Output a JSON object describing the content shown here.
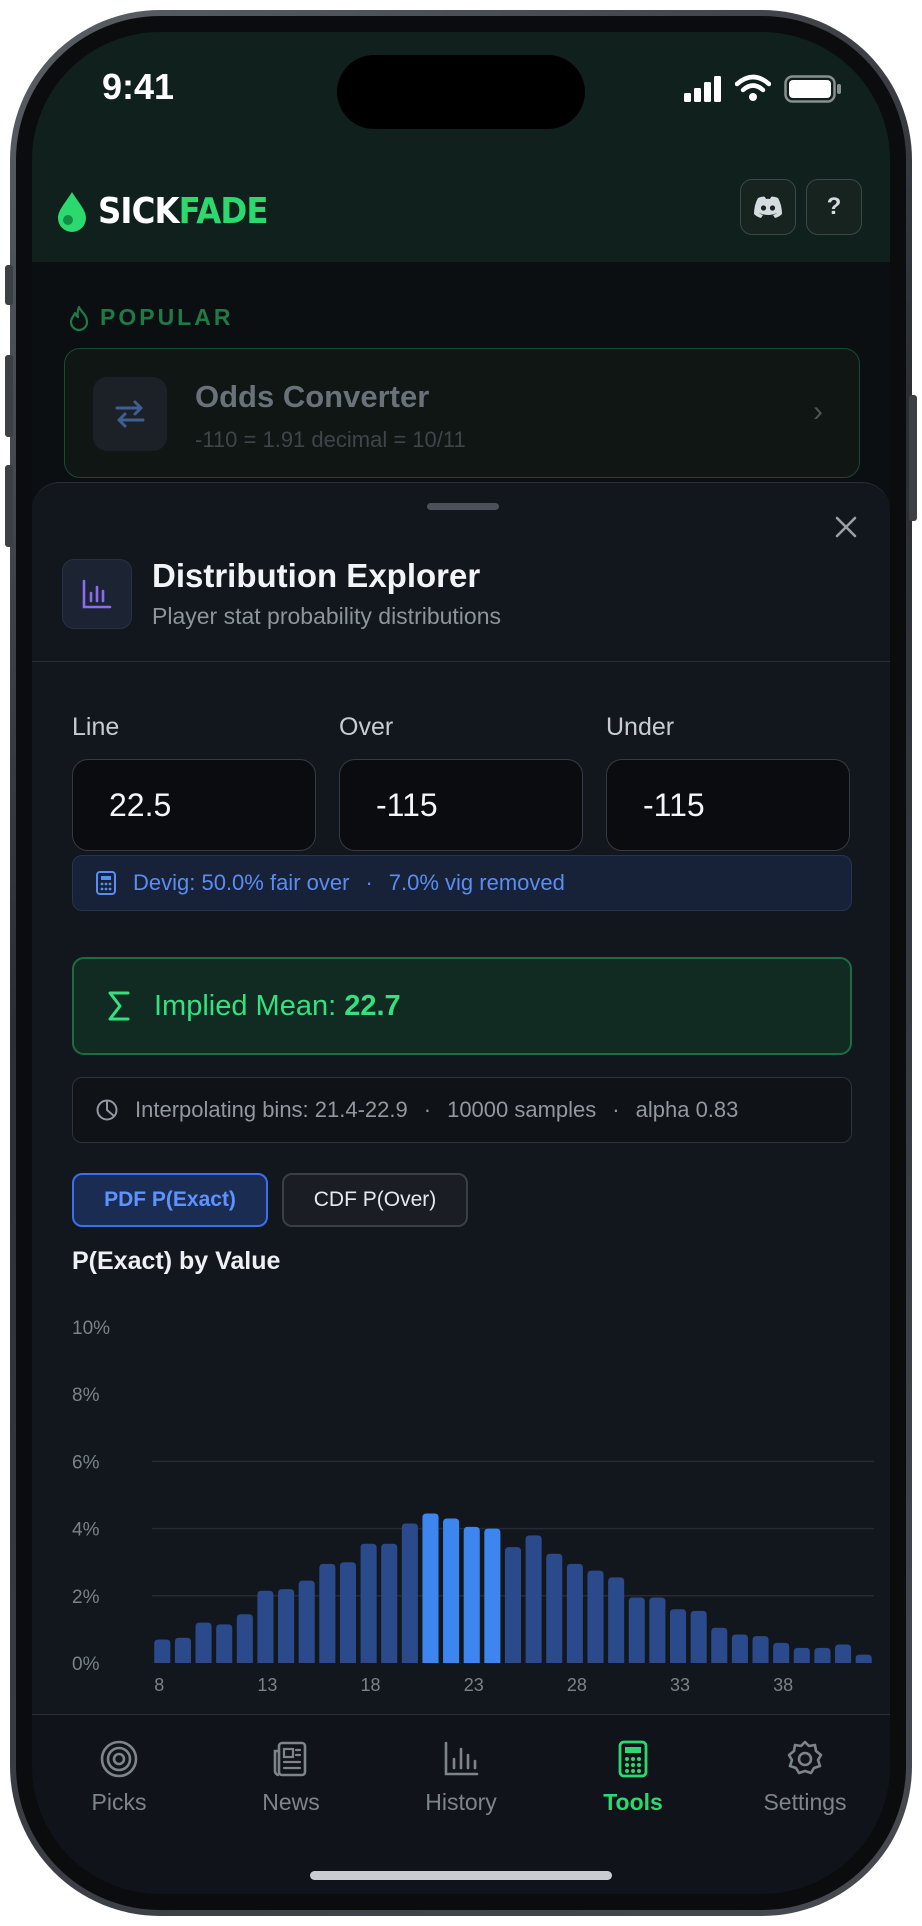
{
  "status": {
    "time": "9:41"
  },
  "brand": {
    "part1": "SICK",
    "part2": "FADE"
  },
  "header": {
    "help_label": "?"
  },
  "popular": {
    "section_label": "POPULAR",
    "card": {
      "title": "Odds Converter",
      "subtitle": "-110 = 1.91 decimal = 10/11"
    }
  },
  "sheet": {
    "title": "Distribution Explorer",
    "subtitle": "Player stat probability distributions",
    "fields": [
      {
        "label": "Line",
        "value": "22.5"
      },
      {
        "label": "Over",
        "value": "-115"
      },
      {
        "label": "Under",
        "value": "-115"
      }
    ],
    "devig": {
      "text1": "Devig: 50.0% fair over",
      "sep": "·",
      "text2": "7.0% vig removed"
    },
    "implied_mean": {
      "label": "Implied Mean:",
      "value": "22.7"
    },
    "interp": {
      "bins": "Interpolating bins: 21.4-22.9",
      "samples": "10000 samples",
      "alpha": "alpha 0.83",
      "sep": "·"
    },
    "toggles": {
      "pdf": "PDF  P(Exact)",
      "cdf": "CDF  P(Over)"
    },
    "chart_title": "P(Exact) by Value"
  },
  "chart_data": {
    "type": "bar",
    "title": "P(Exact) by Value",
    "ylim": [
      0,
      10
    ],
    "y_ticks": [
      "10%",
      "8%",
      "6%",
      "4%",
      "2%",
      "0%"
    ],
    "x_tick_labels": [
      "8",
      "13",
      "18",
      "23",
      "28",
      "33",
      "38"
    ],
    "categories": [
      8,
      9,
      10,
      11,
      12,
      13,
      14,
      15,
      16,
      17,
      18,
      19,
      20,
      21,
      22,
      23,
      24,
      25,
      26,
      27,
      28,
      29,
      30,
      31,
      32,
      33,
      34,
      35,
      36,
      37,
      38,
      39,
      40,
      41,
      42
    ],
    "values": [
      0.7,
      0.75,
      1.2,
      1.15,
      1.45,
      2.15,
      2.2,
      2.45,
      2.95,
      3.0,
      3.55,
      3.55,
      4.15,
      4.45,
      4.3,
      4.05,
      4.0,
      3.45,
      3.8,
      3.25,
      2.95,
      2.75,
      2.55,
      1.95,
      1.95,
      1.6,
      1.55,
      1.05,
      0.85,
      0.8,
      0.6,
      0.45,
      0.45,
      0.55,
      0.25
    ],
    "highlight": [
      21,
      22,
      23,
      24
    ],
    "colors": {
      "bar": "#2b4a8c",
      "highlight": "#3d86f0",
      "grid": "#262b33",
      "tick": "#7b828a"
    }
  },
  "tabs": [
    {
      "label": "Picks",
      "icon": "target-icon",
      "active": false
    },
    {
      "label": "News",
      "icon": "newspaper-icon",
      "active": false
    },
    {
      "label": "History",
      "icon": "bar-chart-icon",
      "active": false
    },
    {
      "label": "Tools",
      "icon": "calculator-icon",
      "active": true
    },
    {
      "label": "Settings",
      "icon": "gear-icon",
      "active": false
    }
  ],
  "colors": {
    "brand_green": "#2bd96f",
    "accent_blue": "#3a6ff0"
  }
}
